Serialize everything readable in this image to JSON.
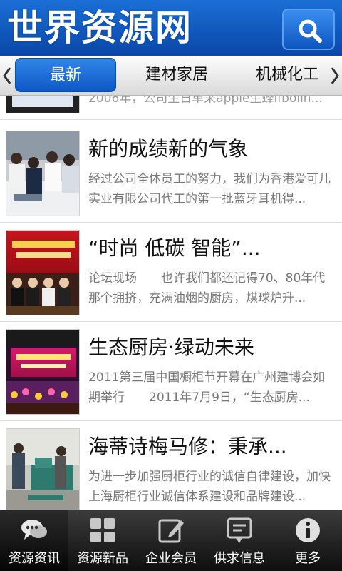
{
  "header": {
    "logo_text": "世界资源网",
    "search_icon": "search-icon"
  },
  "tabs": [
    {
      "label": "最新",
      "active": true
    },
    {
      "label": "建材家居",
      "active": false
    },
    {
      "label": "机械化工",
      "active": false
    }
  ],
  "articles": [
    {
      "title": "",
      "summary": "2006年，公司生日单采apple生蜂ifbolin..."
    },
    {
      "title": "新的成绩新的气象",
      "summary": "经过公司全体员工的努力，我们为香港爱可儿实业有限公司代工的第一批蓝牙耳机得..."
    },
    {
      "title": "“时尚 低碳 智能”...",
      "summary": "论坛现场　　也许我们都还记得70、80年代那个拥挤，充满油烟的厨房，煤球炉升..."
    },
    {
      "title": "生态厨房·绿动未来",
      "summary": "2011第三届中国橱柜节开幕在广州建博会如期举行　　2011年7月9日，“生态厨房..."
    },
    {
      "title": "海蒂诗梅马修：秉承...",
      "summary": "为进一步加强厨柜行业的诚信自律建设，加快上海厨柜行业诚信体系建设和品牌建设..."
    }
  ],
  "bottom_nav": [
    {
      "label": "资源资讯",
      "icon": "chat-bubbles-icon",
      "active": true
    },
    {
      "label": "资源新品",
      "icon": "grid-icon",
      "active": false
    },
    {
      "label": "企业会员",
      "icon": "edit-icon",
      "active": false
    },
    {
      "label": "供求信息",
      "icon": "message-icon",
      "active": false
    },
    {
      "label": "更多",
      "icon": "info-icon",
      "active": false
    }
  ],
  "colors": {
    "header_blue": "#0a47a8",
    "tab_active": "#1b6fd6",
    "nav_bg": "#1a1a1a",
    "summary_gray": "#777777"
  }
}
